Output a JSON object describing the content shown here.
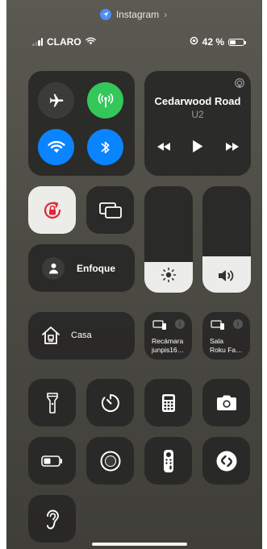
{
  "top_app": {
    "name": "Instagram",
    "chevron": "›"
  },
  "status_bar": {
    "carrier": "CLARO",
    "battery_percent_label": "42 %",
    "battery_level": 0.42
  },
  "connectivity": {
    "airplane": {
      "icon": "airplane-icon",
      "on": false
    },
    "cellular": {
      "icon": "antenna-icon",
      "on": true,
      "color": "#34c759"
    },
    "wifi": {
      "icon": "wifi-icon",
      "on": true,
      "color": "#0a84ff"
    },
    "bluetooth": {
      "icon": "bluetooth-icon",
      "on": true,
      "color": "#0a84ff"
    }
  },
  "now_playing": {
    "title": "Cedarwood Road",
    "artist": "U2",
    "icons": [
      "airplay-icon",
      "rewind-icon",
      "play-icon",
      "fast-forward-icon"
    ]
  },
  "toggles": {
    "orientation_lock": {
      "icon": "rotation-lock-icon",
      "on": true,
      "accent": "#e5243b"
    },
    "screen_mirroring": {
      "icon": "screen-mirroring-icon"
    }
  },
  "sliders": {
    "brightness": {
      "icon": "sun-icon",
      "level": 0.29
    },
    "volume": {
      "icon": "speaker-icon",
      "level": 0.34
    }
  },
  "focus": {
    "label": "Enfoque",
    "icon": "person-icon"
  },
  "home": {
    "label": "Casa",
    "icon": "house-icon"
  },
  "tv_devices": [
    {
      "line1": "Recámara",
      "line2": "junpis16…",
      "icon": "tv-remote-device-icon"
    },
    {
      "line1": "Sala",
      "line2": "Roku Fa…",
      "icon": "tv-remote-device-icon"
    }
  ],
  "shortcuts_row1": [
    "flashlight-icon",
    "timer-icon",
    "calculator-icon",
    "camera-icon"
  ],
  "shortcuts_row2": [
    "low-power-battery-icon",
    "screen-record-icon",
    "apple-tv-remote-icon",
    "shazam-icon"
  ],
  "shortcuts_row3": [
    "hearing-icon"
  ]
}
